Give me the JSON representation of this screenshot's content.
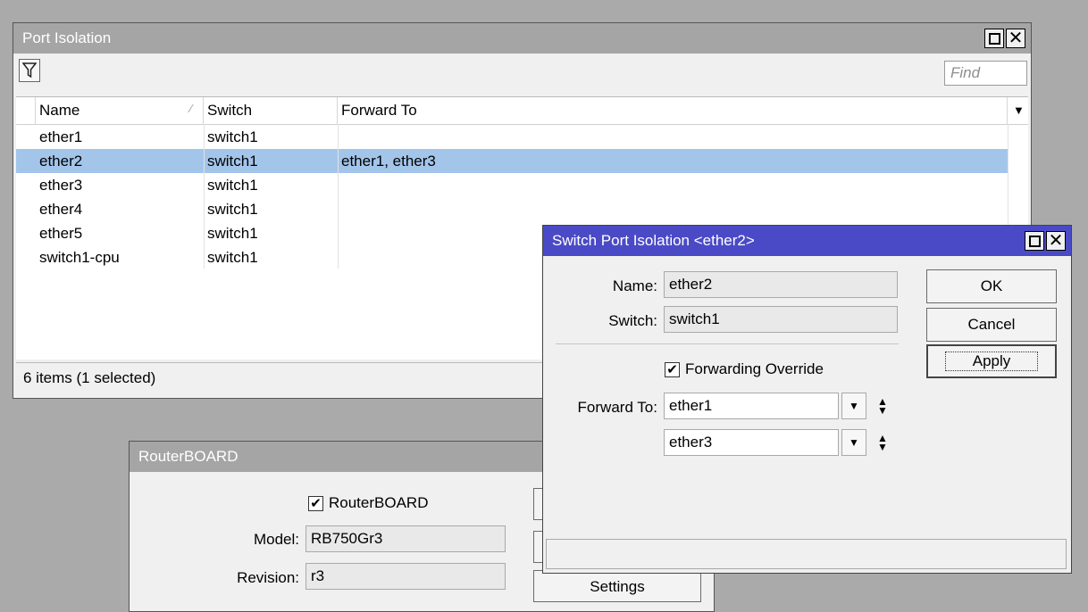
{
  "port_isolation": {
    "title": "Port Isolation",
    "find_placeholder": "Find",
    "columns": [
      "Name",
      "Switch",
      "Forward To"
    ],
    "rows": [
      {
        "name": "ether1",
        "switch": "switch1",
        "forward_to": ""
      },
      {
        "name": "ether2",
        "switch": "switch1",
        "forward_to": "ether1, ether3"
      },
      {
        "name": "ether3",
        "switch": "switch1",
        "forward_to": ""
      },
      {
        "name": "ether4",
        "switch": "switch1",
        "forward_to": ""
      },
      {
        "name": "ether5",
        "switch": "switch1",
        "forward_to": ""
      },
      {
        "name": "switch1-cpu",
        "switch": "switch1",
        "forward_to": ""
      }
    ],
    "selected_row": "ether2",
    "status": "6 items (1 selected)"
  },
  "routerboard": {
    "title": "RouterBOARD",
    "checkbox_label": "RouterBOARD",
    "checked": true,
    "model_label": "Model:",
    "model_value": "RB750Gr3",
    "revision_label": "Revision:",
    "revision_value": "r3",
    "settings_button": "Settings"
  },
  "dialog": {
    "title": "Switch Port Isolation <ether2>",
    "name_label": "Name:",
    "name_value": "ether2",
    "switch_label": "Switch:",
    "switch_value": "switch1",
    "override_label": "Forwarding Override",
    "override_checked": true,
    "forward_to_label": "Forward To:",
    "forward_to": [
      "ether1",
      "ether3"
    ],
    "ok_button": "OK",
    "cancel_button": "Cancel",
    "apply_button": "Apply"
  },
  "colors": {
    "selection": "#a3c5ea",
    "active_title": "#4a4ac7",
    "inactive_title": "#a5a5a5"
  }
}
